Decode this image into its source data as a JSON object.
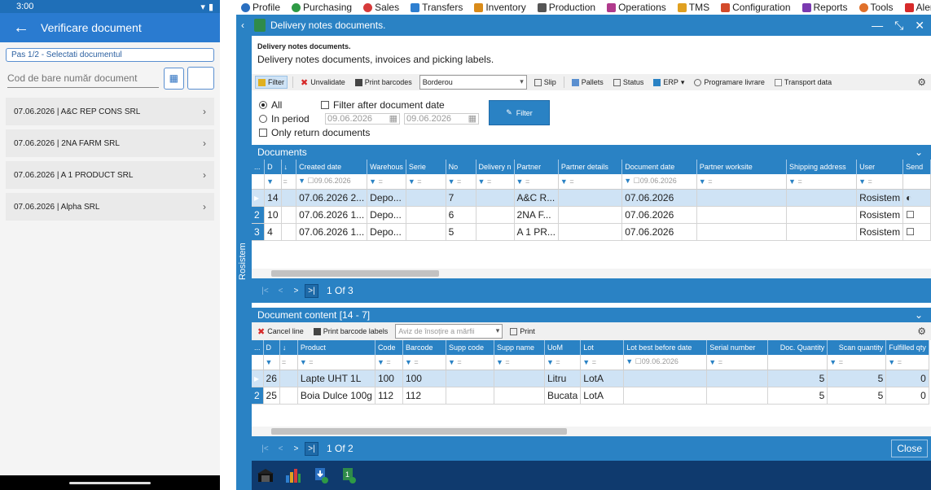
{
  "phone": {
    "time": "3:00",
    "title": "Verificare document",
    "step": "Pas 1/2 - Selectati documentul",
    "barcode_placeholder": "Cod de bare număr document",
    "documents": [
      "07.06.2026 | A&C REP CONS SRL",
      "07.06.2026 | 2NA FARM SRL",
      "07.06.2026 | A 1 PRODUCT SRL",
      "07.06.2026 | Alpha SRL"
    ]
  },
  "menu": [
    "Profile",
    "Purchasing",
    "Sales",
    "Transfers",
    "Inventory",
    "Production",
    "Operations",
    "TMS",
    "Configuration",
    "Reports",
    "Tools",
    "Alerts"
  ],
  "menu_colors": [
    "#2a6fc0",
    "#2e9a45",
    "#d63a3a",
    "#2e7fd0",
    "#d98b1a",
    "#555555",
    "#b03a8c",
    "#e0a020",
    "#d34a2a",
    "#7a3ab0",
    "#e0702a",
    "#d62a2a"
  ],
  "window": {
    "title": "Delivery notes documents.",
    "desc_bold": "Delivery notes documents.",
    "desc": "Delivery notes documents, invoices and picking labels.",
    "side_tab": "Rosistem"
  },
  "toolbar": {
    "filter": "Filter",
    "unvalidate": "Unvalidate",
    "print_barcodes": "Print barcodes",
    "report_select": "Borderou",
    "slip": "Slip",
    "pallets": "Pallets",
    "status": "Status",
    "erp": "ERP",
    "programare": "Programare livrare",
    "transport": "Transport data"
  },
  "filters": {
    "all": "All",
    "in_period": "In period",
    "filter_after": "Filter after document date",
    "date_from": "09.06.2026",
    "date_to": "09.06.2026",
    "only_return": "Only return documents",
    "filter_btn": "Filter"
  },
  "documents_grid": {
    "title": "Documents",
    "columns": [
      "...",
      "D",
      "",
      "Created date",
      "Warehous",
      "Serie",
      "No",
      "Delivery n",
      "Partner",
      "Partner details",
      "Document date",
      "Partner worksite",
      "Shipping address",
      "User",
      "Send"
    ],
    "filter_date": "09.06.2026",
    "rows": [
      {
        "rn": "",
        "d": "14",
        "created": "07.06.2026 2...",
        "wh": "Depo...",
        "serie": "",
        "no": "7",
        "delivery": "",
        "partner": "A&C R...",
        "details": "",
        "doc_date": "07.06.2026",
        "worksite": "",
        "address": "",
        "user": "Rosistem"
      },
      {
        "rn": "2",
        "d": "10",
        "created": "07.06.2026 1...",
        "wh": "Depo...",
        "serie": "",
        "no": "6",
        "delivery": "",
        "partner": "2NA F...",
        "details": "",
        "doc_date": "07.06.2026",
        "worksite": "",
        "address": "",
        "user": "Rosistem"
      },
      {
        "rn": "3",
        "d": "4",
        "created": "07.06.2026 1...",
        "wh": "Depo...",
        "serie": "",
        "no": "5",
        "delivery": "",
        "partner": "A 1 PR...",
        "details": "",
        "doc_date": "07.06.2026",
        "worksite": "",
        "address": "",
        "user": "Rosistem"
      }
    ],
    "pager": "1 Of 3"
  },
  "content_grid": {
    "title": "Document content [14 - 7]",
    "cancel_line": "Cancel line",
    "print_labels": "Print barcode labels",
    "select_placeholder": "Aviz de însoțire a mărfii",
    "print": "Print",
    "columns": [
      "...",
      "D",
      "",
      "Product",
      "Code",
      "Barcode",
      "Supp code",
      "Supp name",
      "UoM",
      "Lot",
      "Lot best before date",
      "Serial number",
      "Doc. Quantity",
      "Scan quantity",
      "Fulfilled qty"
    ],
    "filter_date": "09.06.2026",
    "rows": [
      {
        "rn": "",
        "d": "26",
        "product": "Lapte UHT 1L",
        "code": "100",
        "barcode": "100",
        "supp_code": "",
        "supp_name": "",
        "uom": "Litru",
        "lot": "LotA",
        "bb": "",
        "serial": "",
        "doc_qty": "5",
        "scan_qty": "5",
        "fulfilled": "0"
      },
      {
        "rn": "2",
        "d": "25",
        "product": "Boia Dulce 100g",
        "code": "112",
        "barcode": "112",
        "supp_code": "",
        "supp_name": "",
        "uom": "Bucata",
        "lot": "LotA",
        "bb": "",
        "serial": "",
        "doc_qty": "5",
        "scan_qty": "5",
        "fulfilled": "0"
      }
    ],
    "pager": "1 Of 2",
    "close": "Close"
  }
}
